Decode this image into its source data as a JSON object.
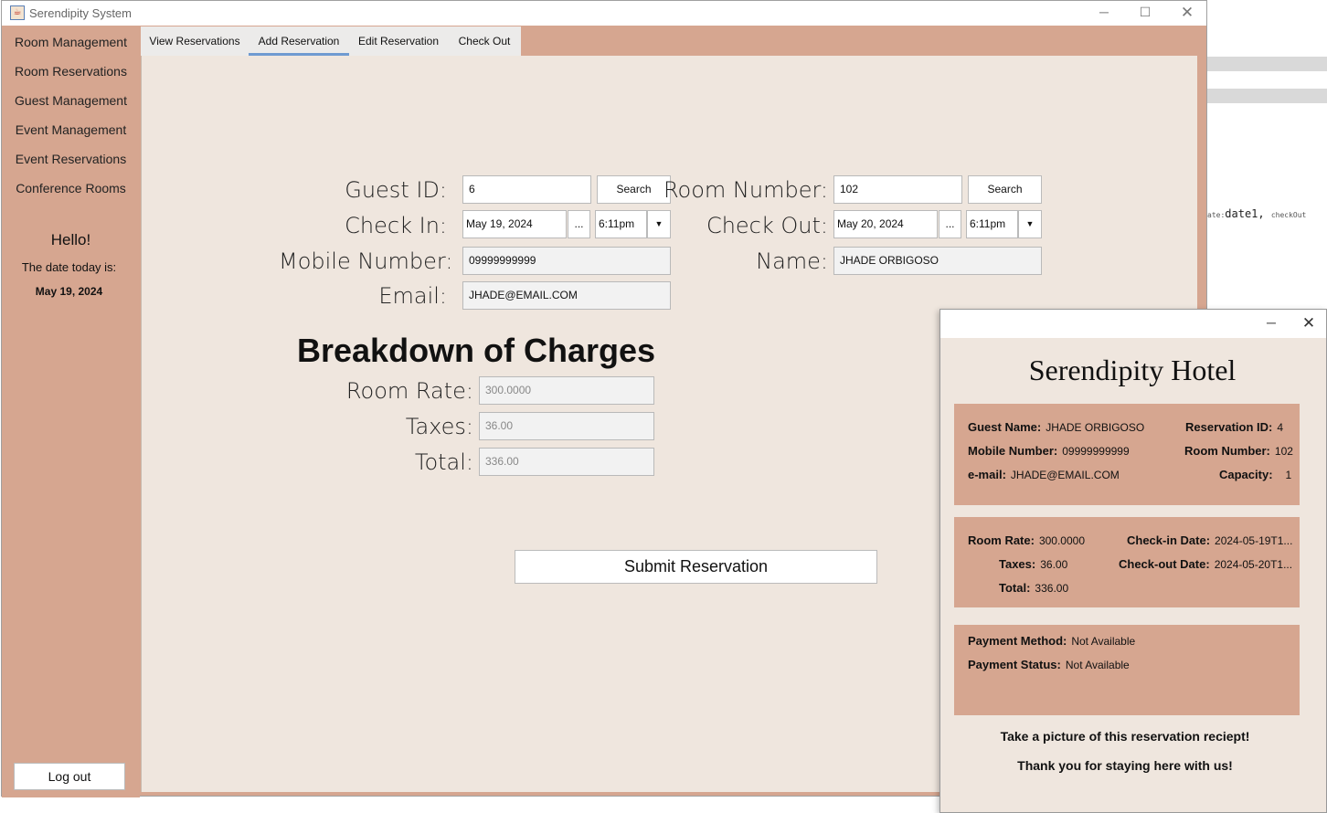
{
  "window": {
    "title": "Serendipity System",
    "app_icon": "java-cup-icon",
    "minimize": "─",
    "maximize": "☐",
    "close": "✕"
  },
  "sidebar": {
    "items": [
      {
        "label": "Room Management"
      },
      {
        "label": "Room Reservations"
      },
      {
        "label": "Guest Management"
      },
      {
        "label": "Event Management"
      },
      {
        "label": "Event Reservations"
      },
      {
        "label": "Conference Rooms"
      }
    ],
    "greeting": "Hello!",
    "date_label": "The date today is:",
    "date_value": "May 19, 2024",
    "logout_label": "Log out"
  },
  "tabs": [
    {
      "label": "View Reservations"
    },
    {
      "label": "Add Reservation",
      "active": true
    },
    {
      "label": "Edit Reservation"
    },
    {
      "label": "Check Out"
    }
  ],
  "form": {
    "guest_id_label": "Guest  ID:",
    "guest_id_value": "6",
    "guest_search": "Search",
    "room_number_label": "Room Number:",
    "room_number_value": "102",
    "room_search": "Search",
    "check_in_label": "Check In:",
    "check_in_date": "May 19, 2024",
    "check_in_time": "6:11pm",
    "check_out_label": "Check Out:",
    "check_out_date": "May 20, 2024",
    "check_out_time": "6:11pm",
    "ellipsis": "...",
    "dropdown": "▼",
    "mobile_label": "Mobile Number:",
    "mobile_value": "09999999999",
    "name_label": "Name:",
    "name_value": "JHADE ORBIGOSO",
    "email_label": "Email:",
    "email_value": "JHADE@EMAIL.COM"
  },
  "charges": {
    "heading": "Breakdown of Charges",
    "room_rate_label": "Room Rate:",
    "room_rate_value": "300.0000",
    "taxes_label": "Taxes:",
    "taxes_value": "36.00",
    "total_label": "Total:",
    "total_value": "336.00"
  },
  "submit_label": "Submit Reservation",
  "receipt": {
    "minimize": "─",
    "close": "✕",
    "hotel_name": "Serendipity Hotel",
    "guest_name_label": "Guest Name:",
    "guest_name_value": "JHADE ORBIGOSO",
    "reservation_id_label": "Reservation ID:",
    "reservation_id_value": "4",
    "mobile_label": "Mobile Number:",
    "mobile_value": "09999999999",
    "room_number_label": "Room Number:",
    "room_number_value": "102",
    "email_label": "e-mail:",
    "email_value": "JHADE@EMAIL.COM",
    "capacity_label": "Capacity:",
    "capacity_value": "1",
    "room_rate_label": "Room Rate:",
    "room_rate_value": "300.0000",
    "check_in_label": "Check-in Date:",
    "check_in_value": "2024-05-19T1...",
    "taxes_label": "Taxes:",
    "taxes_value": "36.00",
    "check_out_label": "Check-out Date:",
    "check_out_value": "2024-05-20T1...",
    "total_label": "Total:",
    "total_value": "336.00",
    "payment_method_label": "Payment Method:",
    "payment_method_value": "Not Available",
    "payment_status_label": "Payment Status:",
    "payment_status_value": "Not Available",
    "note1": "Take a picture of this reservation reciept!",
    "note2": "Thank you for staying here with us!"
  },
  "background_editor": {
    "code_prefix": "ate:",
    "code_main": "date1, ",
    "code_suffix": "checkOut"
  },
  "colors": {
    "accent": "#d6a690",
    "content_bg": "#efe6de",
    "tab_active": "#6f9ad1"
  }
}
